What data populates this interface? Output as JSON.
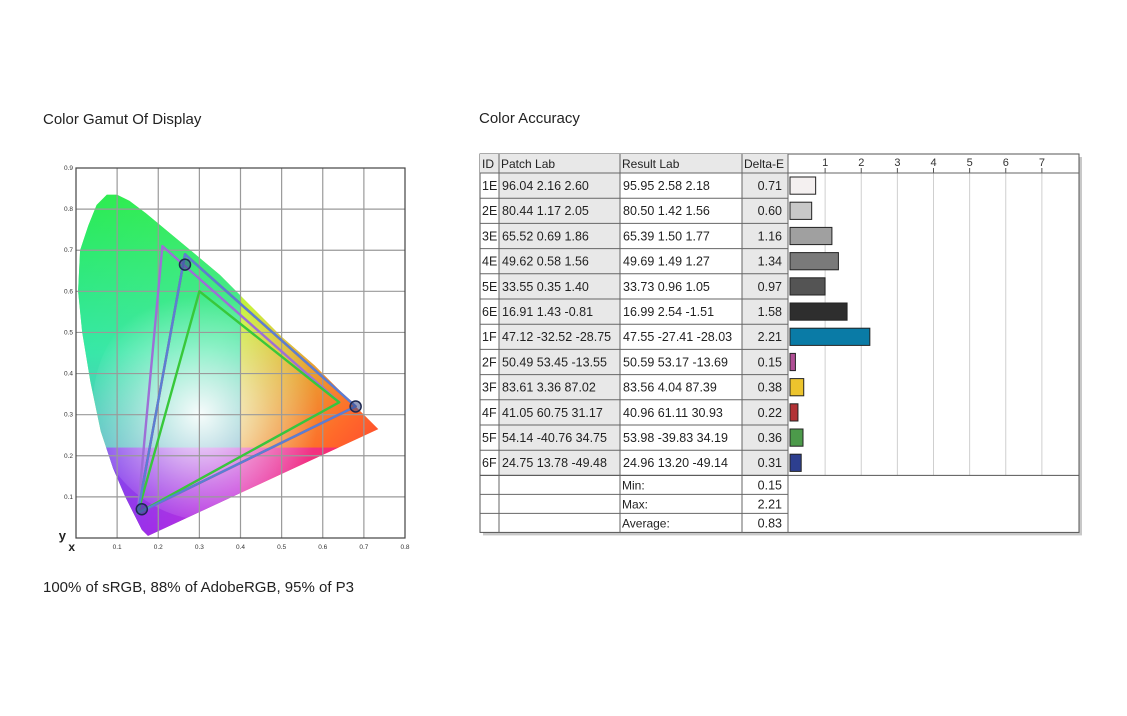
{
  "gamut": {
    "title": "Color Gamut Of Display",
    "caption": "100% of sRGB, 88% of AdobeRGB, 95% of P3",
    "axis_x_letter": "x",
    "axis_y_letter": "y",
    "x_ticks": [
      "0.1",
      "0.2",
      "0.3",
      "0.4",
      "0.5",
      "0.6",
      "0.7",
      "0.8"
    ],
    "y_ticks": [
      "0.1",
      "0.2",
      "0.3",
      "0.4",
      "0.5",
      "0.6",
      "0.7",
      "0.8",
      "0.9"
    ]
  },
  "accuracy": {
    "title": "Color Accuracy",
    "headers": {
      "id": "ID",
      "patch": "Patch Lab",
      "result": "Result Lab",
      "delta": "Delta-E"
    },
    "scale_ticks": [
      "1",
      "2",
      "3",
      "4",
      "5",
      "6",
      "7"
    ],
    "summary": [
      {
        "label": "Min:",
        "value": "0.15"
      },
      {
        "label": "Max:",
        "value": "2.21"
      },
      {
        "label": "Average:",
        "value": "0.83"
      }
    ]
  },
  "chart_data": [
    {
      "type": "scatter",
      "title": "Color Gamut Of Display",
      "xlim": [
        0,
        0.8
      ],
      "ylim": [
        0,
        0.9
      ],
      "xlabel": "x",
      "ylabel": "y",
      "grid": true,
      "series": [
        {
          "color": "#e0303a",
          "points": [
            [
              0.68,
              0.32
            ],
            [
              0.265,
              0.69
            ],
            [
              0.15,
              0.06
            ]
          ]
        },
        {
          "color": "#9d6fd6",
          "points": [
            [
              0.64,
              0.33
            ],
            [
              0.21,
              0.71
            ],
            [
              0.15,
              0.06
            ]
          ]
        },
        {
          "color": "#38c83a",
          "points": [
            [
              0.64,
              0.33
            ],
            [
              0.3,
              0.6
            ],
            [
              0.15,
              0.06
            ]
          ]
        },
        {
          "color": "#5a7fd4",
          "points": [
            [
              0.68,
              0.32
            ],
            [
              0.265,
              0.69
            ],
            [
              0.15,
              0.06
            ]
          ]
        }
      ],
      "markers": [
        [
          0.68,
          0.32
        ],
        [
          0.265,
          0.665
        ],
        [
          0.16,
          0.07
        ]
      ]
    },
    {
      "type": "bar",
      "title": "Color Accuracy",
      "xlim": [
        0,
        8
      ],
      "categories": [
        "1E",
        "2E",
        "3E",
        "4E",
        "5E",
        "6E",
        "1F",
        "2F",
        "3F",
        "4F",
        "5F",
        "6F"
      ],
      "rows": [
        {
          "id": "1E",
          "patch": [
            "96.04",
            "2.16",
            "2.60"
          ],
          "result": [
            "95.95",
            "2.58",
            "2.18"
          ],
          "delta": "0.71",
          "value": 0.71,
          "color": "#f4f0f0"
        },
        {
          "id": "2E",
          "patch": [
            "80.44",
            "1.17",
            "2.05"
          ],
          "result": [
            "80.50",
            "1.42",
            "1.56"
          ],
          "delta": "0.60",
          "value": 0.6,
          "color": "#c8c8c8"
        },
        {
          "id": "3E",
          "patch": [
            "65.52",
            "0.69",
            "1.86"
          ],
          "result": [
            "65.39",
            "1.50",
            "1.77"
          ],
          "delta": "1.16",
          "value": 1.16,
          "color": "#a0a0a0"
        },
        {
          "id": "4E",
          "patch": [
            "49.62",
            "0.58",
            "1.56"
          ],
          "result": [
            "49.69",
            "1.49",
            "1.27"
          ],
          "delta": "1.34",
          "value": 1.34,
          "color": "#7a7a7a"
        },
        {
          "id": "5E",
          "patch": [
            "33.55",
            "0.35",
            "1.40"
          ],
          "result": [
            "33.73",
            "0.96",
            "1.05"
          ],
          "delta": "0.97",
          "value": 0.97,
          "color": "#545454"
        },
        {
          "id": "6E",
          "patch": [
            "16.91",
            "1.43",
            "-0.81"
          ],
          "result": [
            "16.99",
            "2.54",
            "-1.51"
          ],
          "delta": "1.58",
          "value": 1.58,
          "color": "#2e2e2e"
        },
        {
          "id": "1F",
          "patch": [
            "47.12",
            "-32.52",
            "-28.75"
          ],
          "result": [
            "47.55",
            "-27.41",
            "-28.03"
          ],
          "delta": "2.21",
          "value": 2.21,
          "color": "#0a7ba6"
        },
        {
          "id": "2F",
          "patch": [
            "50.49",
            "53.45",
            "-13.55"
          ],
          "result": [
            "50.59",
            "53.17",
            "-13.69"
          ],
          "delta": "0.15",
          "value": 0.15,
          "color": "#b04f95"
        },
        {
          "id": "3F",
          "patch": [
            "83.61",
            "3.36",
            "87.02"
          ],
          "result": [
            "83.56",
            "4.04",
            "87.39"
          ],
          "delta": "0.38",
          "value": 0.38,
          "color": "#ecc42d"
        },
        {
          "id": "4F",
          "patch": [
            "41.05",
            "60.75",
            "31.17"
          ],
          "result": [
            "40.96",
            "61.11",
            "30.93"
          ],
          "delta": "0.22",
          "value": 0.22,
          "color": "#b23236"
        },
        {
          "id": "5F",
          "patch": [
            "54.14",
            "-40.76",
            "34.75"
          ],
          "result": [
            "53.98",
            "-39.83",
            "34.19"
          ],
          "delta": "0.36",
          "value": 0.36,
          "color": "#4c9a4a"
        },
        {
          "id": "6F",
          "patch": [
            "24.75",
            "13.78",
            "-49.48"
          ],
          "result": [
            "24.96",
            "13.20",
            "-49.14"
          ],
          "delta": "0.31",
          "value": 0.31,
          "color": "#2d3f8f"
        }
      ]
    }
  ]
}
